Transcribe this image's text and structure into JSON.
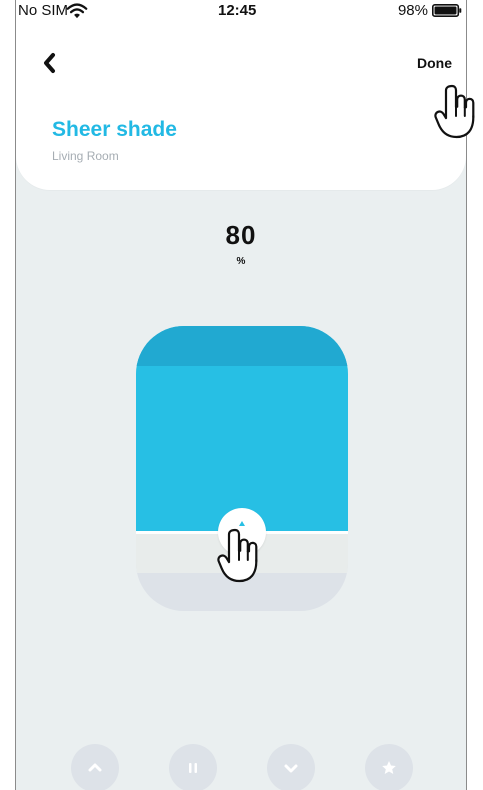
{
  "status_bar": {
    "carrier": "No SIM",
    "time": "12:45",
    "battery": "98%"
  },
  "header": {
    "done_label": "Done",
    "device_name": "Sheer shade",
    "room_name": "Living Room"
  },
  "shade": {
    "position_value": "80",
    "position_unit": "%"
  },
  "icons": {
    "wifi": "wifi-icon",
    "battery": "battery-icon",
    "back": "chevron-left-icon",
    "handle": "chevron-up-icon",
    "up": "chevron-up-icon",
    "pause": "pause-icon",
    "down": "chevron-down-icon",
    "favorite": "star-icon",
    "pointer": "hand-pointer-icon"
  },
  "colors": {
    "accent": "#27bfe4",
    "accent_dark": "#21a9d1",
    "background": "#eaeff0",
    "card": "#ffffff",
    "muted": "#a6adb3",
    "control": "#dde2e8"
  }
}
